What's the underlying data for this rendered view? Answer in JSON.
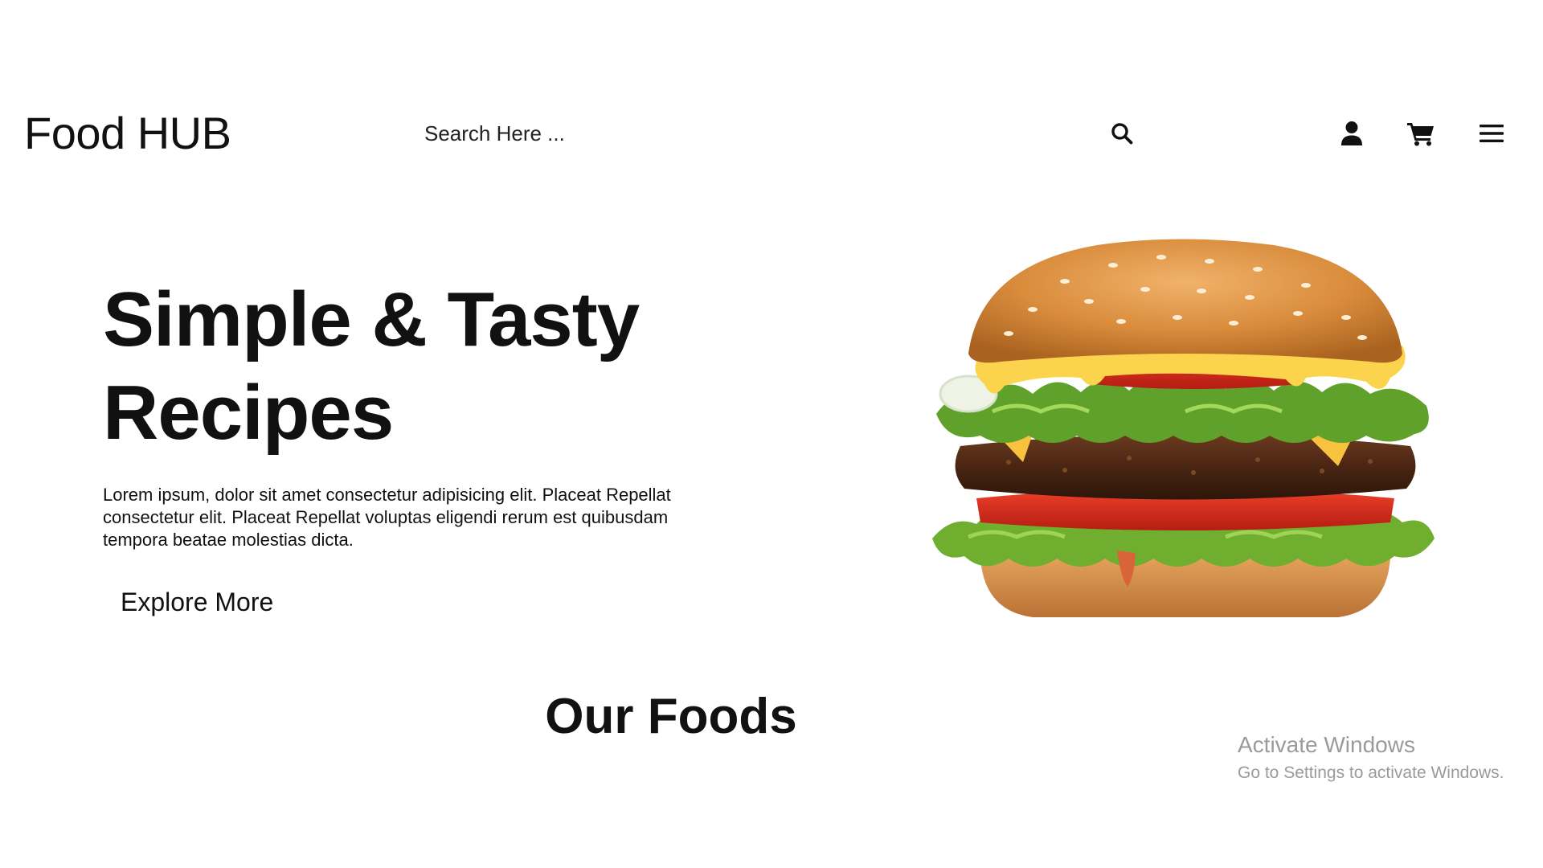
{
  "header": {
    "logo": "Food HUB",
    "search_placeholder": "Search Here ...",
    "icons": [
      "search-icon",
      "user-icon",
      "cart-icon",
      "menu-icon"
    ]
  },
  "hero": {
    "title_line1": "Simple & Tasty",
    "title_line2": "Recipes",
    "description": "Lorem ipsum, dolor sit amet consectetur adipisicing elit. Placeat Repellat consectetur elit. Placeat Repellat voluptas eligendi rerum est quibusdam tempora beatae molestias dicta.",
    "button_label": "Explore More"
  },
  "section": {
    "title": "Our Foods"
  },
  "watermark": {
    "title": "Activate Windows",
    "subtitle": "Go to Settings to activate Windows."
  },
  "colors": {
    "background": "#ffffff",
    "text": "#111111",
    "watermark": "#9a9a9a"
  }
}
